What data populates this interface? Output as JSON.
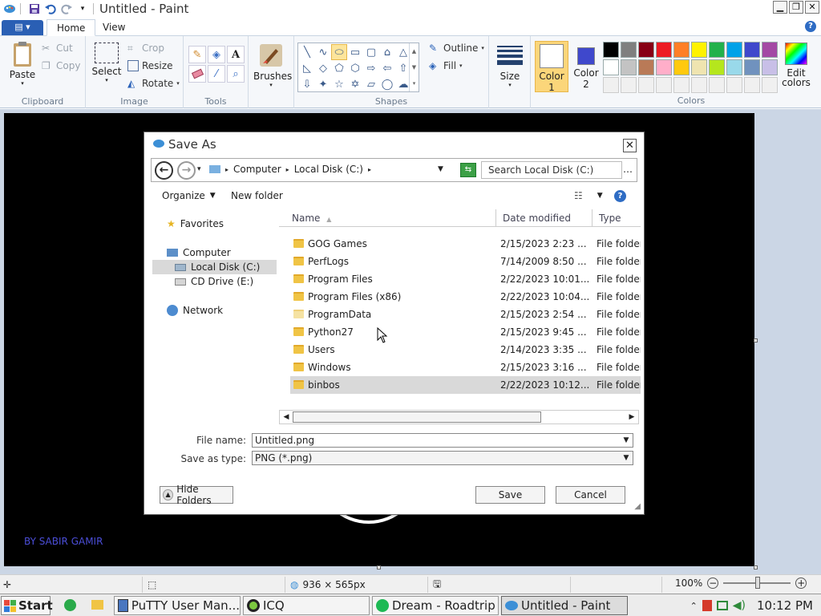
{
  "app": {
    "title": "Untitled - Paint",
    "window_controls": [
      "minimize",
      "restore",
      "close"
    ]
  },
  "ribbon": {
    "file_menu_label": "",
    "tabs": [
      {
        "label": "Home",
        "active": true
      },
      {
        "label": "View",
        "active": false
      }
    ],
    "clipboard": {
      "paste": "Paste",
      "cut": "Cut",
      "copy": "Copy",
      "group": "Clipboard"
    },
    "image": {
      "select": "Select",
      "crop": "Crop",
      "resize": "Resize",
      "rotate": "Rotate",
      "group": "Image"
    },
    "tools": {
      "group": "Tools"
    },
    "brushes": {
      "label": "Brushes"
    },
    "shapes": {
      "outline": "Outline",
      "fill": "Fill",
      "group": "Shapes"
    },
    "size": {
      "label": "Size"
    },
    "color1": {
      "label_line1": "Color",
      "label_line2": "1"
    },
    "color2": {
      "label_line1": "Color",
      "label_line2": "2"
    },
    "colors": {
      "group": "Colors",
      "edit_line1": "Edit",
      "edit_line2": "colors",
      "palette_row1": [
        "#000000",
        "#7f7f7f",
        "#880015",
        "#ed1c24",
        "#ff7f27",
        "#fff200",
        "#22b14c",
        "#00a2e8",
        "#3f48cc",
        "#a349a4"
      ],
      "palette_row2": [
        "#ffffff",
        "#c3c3c3",
        "#b97a57",
        "#ffaec9",
        "#ffc90e",
        "#efe4b0",
        "#b5e61d",
        "#99d9ea",
        "#7092be",
        "#c8bfe7"
      ],
      "color1_value": "#ffffff",
      "color2_value": "#3f48cc"
    }
  },
  "canvas": {
    "credit_text": "BY SABIR GAMIR"
  },
  "status": {
    "dimensions": "936 × 565px",
    "zoom": "100%"
  },
  "dialog": {
    "title": "Save As",
    "breadcrumb": [
      "Computer",
      "Local Disk (C:)"
    ],
    "search_placeholder": "Search Local Disk (C:)",
    "organize": "Organize",
    "new_folder": "New folder",
    "nav": {
      "favorites": "Favorites",
      "computer": "Computer",
      "local_disk": "Local Disk (C:)",
      "cd_drive": "CD Drive (E:)",
      "network": "Network"
    },
    "columns": {
      "name": "Name",
      "date": "Date modified",
      "type": "Type"
    },
    "files": [
      {
        "name": "GOG Games",
        "date": "2/15/2023 2:23 ...",
        "type": "File folder"
      },
      {
        "name": "PerfLogs",
        "date": "7/14/2009 8:50 ...",
        "type": "File folder"
      },
      {
        "name": "Program Files",
        "date": "2/22/2023 10:01...",
        "type": "File folder"
      },
      {
        "name": "Program Files (x86)",
        "date": "2/22/2023 10:04...",
        "type": "File folder"
      },
      {
        "name": "ProgramData",
        "date": "2/15/2023 2:54 ...",
        "type": "File folder"
      },
      {
        "name": "Python27",
        "date": "2/15/2023 9:45 ...",
        "type": "File folder"
      },
      {
        "name": "Users",
        "date": "2/14/2023 3:35 ...",
        "type": "File folder"
      },
      {
        "name": "Windows",
        "date": "2/15/2023 3:16 ...",
        "type": "File folder"
      },
      {
        "name": "binbos",
        "date": "2/22/2023 10:12...",
        "type": "File folder"
      }
    ],
    "file_name_label": "File name:",
    "file_name_value": "Untitled.png",
    "save_type_label": "Save as type:",
    "save_type_value": "PNG (*.png)",
    "hide_folders": "Hide Folders",
    "save": "Save",
    "cancel": "Cancel"
  },
  "taskbar": {
    "start": "Start",
    "tasks": [
      {
        "label": "PuTTY User Man...",
        "icon": "putty-icon"
      },
      {
        "label": "ICQ",
        "icon": "icq-icon"
      },
      {
        "label": "Dream - Roadtrip",
        "icon": "spotify-icon"
      },
      {
        "label": "Untitled - Paint",
        "icon": "paint-icon"
      }
    ],
    "clock": "10:12 PM"
  }
}
